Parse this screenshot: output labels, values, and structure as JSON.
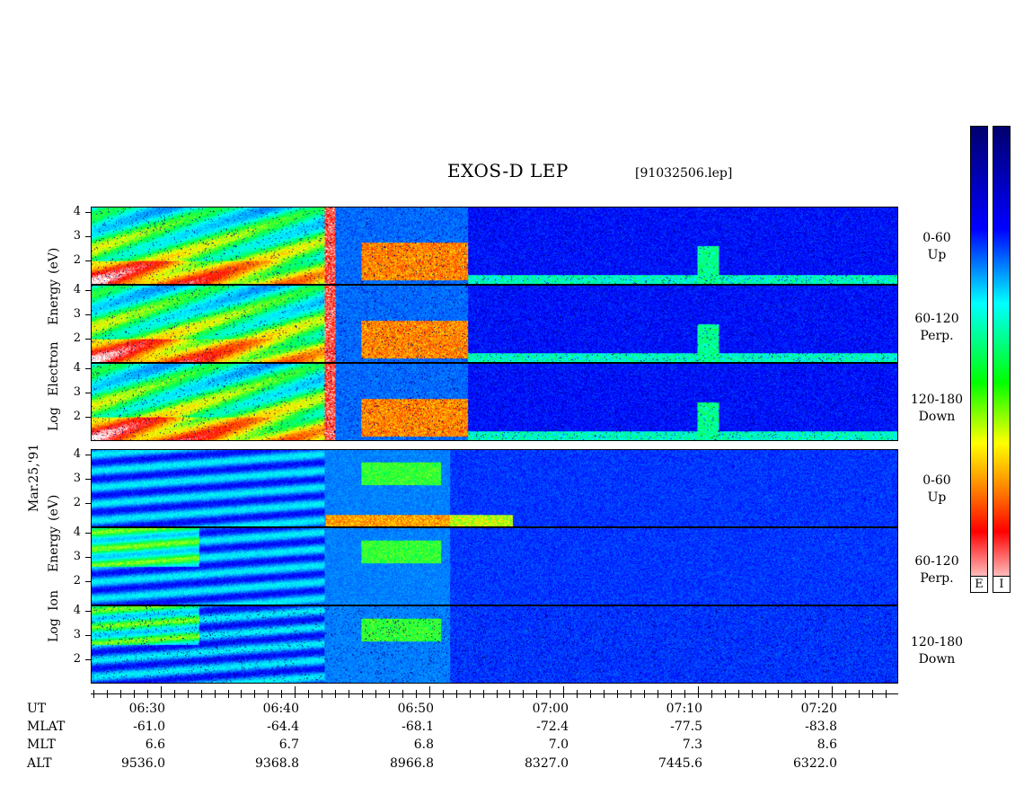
{
  "title": "EXOS-D LEP",
  "filename": "[91032506.lep]",
  "date_label": "Mar.25,'91",
  "electron_axis_label": [
    "Log",
    "Electron",
    "Energy",
    "(eV)"
  ],
  "ion_axis_label": [
    "Log",
    "Ion",
    "Energy",
    "(eV)"
  ],
  "panels": [
    {
      "species": "electron",
      "pitch_range": "0-60",
      "direction": "Up"
    },
    {
      "species": "electron",
      "pitch_range": "60-120",
      "direction": "Perp."
    },
    {
      "species": "electron",
      "pitch_range": "120-180",
      "direction": "Down"
    },
    {
      "species": "ion",
      "pitch_range": "0-60",
      "direction": "Up"
    },
    {
      "species": "ion",
      "pitch_range": "60-120",
      "direction": "Perp."
    },
    {
      "species": "ion",
      "pitch_range": "120-180",
      "direction": "Down"
    }
  ],
  "colorbar_labels": [
    "E",
    "I"
  ],
  "chart_data": {
    "type": "heatmap",
    "title": "EXOS-D LEP",
    "ylabel": "Log Energy (eV)",
    "y_ticks": [
      "4",
      "3",
      "2"
    ],
    "ylim": [
      1,
      4
    ],
    "x_ticks": [
      "06:30",
      "06:40",
      "06:50",
      "07:00",
      "07:10",
      "07:20"
    ],
    "orbit_table": {
      "rows": [
        {
          "name": "UT",
          "values": [
            "06:30",
            "06:40",
            "06:50",
            "07:00",
            "07:10",
            "07:20"
          ]
        },
        {
          "name": "MLAT",
          "values": [
            "-61.0",
            "-64.4",
            "-68.1",
            "-72.4",
            "-77.5",
            "-83.8"
          ]
        },
        {
          "name": "MLT",
          "values": [
            "6.6",
            "6.7",
            "6.8",
            "7.0",
            "7.3",
            "8.6"
          ]
        },
        {
          "name": "ALT",
          "values": [
            "9536.0",
            "9368.8",
            "8966.8",
            "8327.0",
            "7445.6",
            "6322.0"
          ]
        }
      ]
    }
  }
}
